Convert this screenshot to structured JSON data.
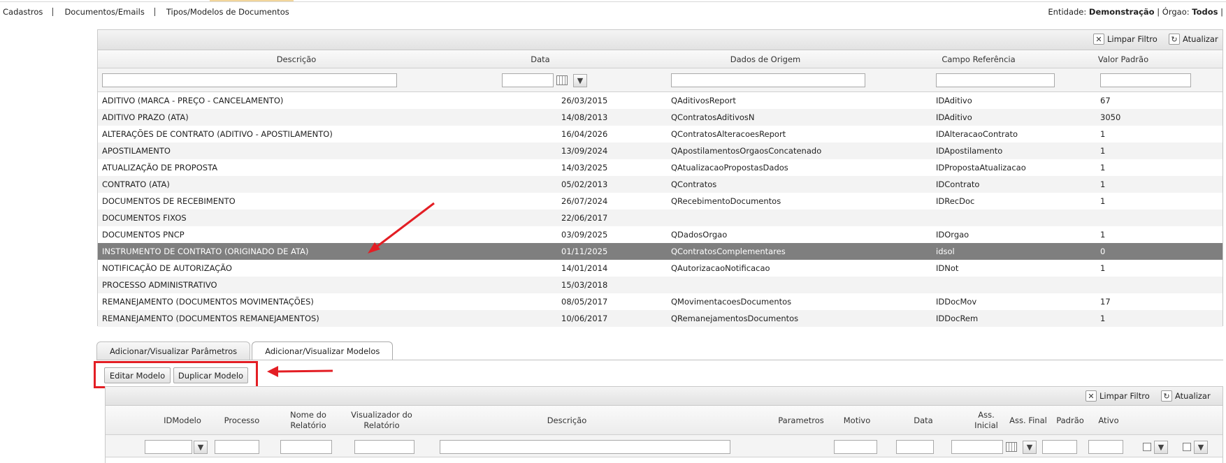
{
  "menu": {
    "items": [
      "Cadastros",
      "Documentos/Emails",
      "Tipos/Modelos de Documentos"
    ]
  },
  "entity": {
    "entidade_label": "Entidade:",
    "entidade_value": "Demonstração",
    "orgao_label": "| Órgao:",
    "orgao_value": "Todos",
    "trailing": "|"
  },
  "grid1": {
    "clear_filter_label": "Limpar Filtro",
    "refresh_label": "Atualizar",
    "columns": [
      "Descrição",
      "Data",
      "Dados de Origem",
      "Campo Referência",
      "Valor Padrão"
    ],
    "rows": [
      [
        "ADITIVO (MARCA - PREÇO - CANCELAMENTO)",
        "26/03/2015",
        "QAditivosReport",
        "IDAditivo",
        "67"
      ],
      [
        "ADITIVO PRAZO (ATA)",
        "14/08/2013",
        "QContratosAditivosN",
        "IDAditivo",
        "3050"
      ],
      [
        "ALTERAÇÕES DE CONTRATO (ADITIVO - APOSTILAMENTO)",
        "16/04/2026",
        "QContratosAlteracoesReport",
        "IDAlteracaoContrato",
        "1"
      ],
      [
        "APOSTILAMENTO",
        "13/09/2024",
        "QApostilamentosOrgaosConcatenado",
        "IDApostilamento",
        "1"
      ],
      [
        "ATUALIZAÇÃO DE PROPOSTA",
        "14/03/2025",
        "QAtualizacaoPropostasDados",
        "IDPropostaAtualizacao",
        "1"
      ],
      [
        "CONTRATO (ATA)",
        "05/02/2013",
        "QContratos",
        "IDContrato",
        "1"
      ],
      [
        "DOCUMENTOS DE RECEBIMENTO",
        "26/07/2024",
        "QRecebimentoDocumentos",
        "IDRecDoc",
        "1"
      ],
      [
        "DOCUMENTOS FIXOS",
        "22/06/2017",
        "",
        "",
        ""
      ],
      [
        "DOCUMENTOS PNCP",
        "03/09/2025",
        "QDadosOrgao",
        "IDOrgao",
        "1"
      ],
      [
        "INSTRUMENTO DE CONTRATO (ORIGINADO DE ATA)",
        "01/11/2025",
        "QContratosComplementares",
        "idsol",
        "0"
      ],
      [
        "NOTIFICAÇÃO DE AUTORIZAÇÃO",
        "14/01/2014",
        "QAutorizacaoNotificacao",
        "IDNot",
        "1"
      ],
      [
        "PROCESSO ADMINISTRATIVO",
        "15/03/2018",
        "",
        "",
        ""
      ],
      [
        "REMANEJAMENTO (DOCUMENTOS MOVIMENTAÇÕES)",
        "08/05/2017",
        "QMovimentacoesDocumentos",
        "IDDocMov",
        "17"
      ],
      [
        "REMANEJAMENTO (DOCUMENTOS REMANEJAMENTOS)",
        "10/06/2017",
        "QRemanejamentosDocumentos",
        "IDDocRem",
        "1"
      ]
    ],
    "selected_row": 9
  },
  "tabs": [
    "Adicionar/Visualizar Parâmetros",
    "Adicionar/Visualizar Modelos"
  ],
  "active_tab": 1,
  "actions": {
    "edit_model": "Editar Modelo",
    "duplicate_model": "Duplicar Modelo"
  },
  "grid2": {
    "clear_filter_label": "Limpar Filtro",
    "refresh_label": "Atualizar",
    "columns": [
      "IDModelo",
      "Processo",
      "Nome do Relatório",
      "Visualizador do Relatório",
      "Descrição",
      "Parametros",
      "Motivo",
      "Data",
      "Ass. Inicial",
      "Ass. Final",
      "Padrão",
      "Ativo"
    ]
  },
  "colors": {
    "selected_row": "#7f7f7f",
    "annotation": "#e31e24"
  },
  "icons": [
    "clear-filter-icon",
    "refresh-icon",
    "calendar-icon",
    "filter-icon",
    "arrow-annotation"
  ]
}
